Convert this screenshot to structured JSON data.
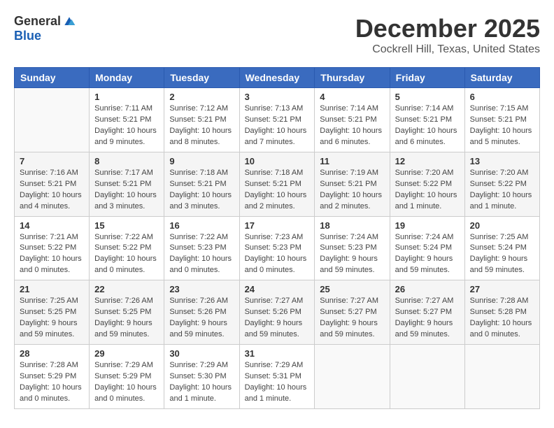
{
  "header": {
    "logo_general": "General",
    "logo_blue": "Blue",
    "month": "December 2025",
    "location": "Cockrell Hill, Texas, United States"
  },
  "weekdays": [
    "Sunday",
    "Monday",
    "Tuesday",
    "Wednesday",
    "Thursday",
    "Friday",
    "Saturday"
  ],
  "weeks": [
    [
      {
        "day": "",
        "info": ""
      },
      {
        "day": "1",
        "info": "Sunrise: 7:11 AM\nSunset: 5:21 PM\nDaylight: 10 hours\nand 9 minutes."
      },
      {
        "day": "2",
        "info": "Sunrise: 7:12 AM\nSunset: 5:21 PM\nDaylight: 10 hours\nand 8 minutes."
      },
      {
        "day": "3",
        "info": "Sunrise: 7:13 AM\nSunset: 5:21 PM\nDaylight: 10 hours\nand 7 minutes."
      },
      {
        "day": "4",
        "info": "Sunrise: 7:14 AM\nSunset: 5:21 PM\nDaylight: 10 hours\nand 6 minutes."
      },
      {
        "day": "5",
        "info": "Sunrise: 7:14 AM\nSunset: 5:21 PM\nDaylight: 10 hours\nand 6 minutes."
      },
      {
        "day": "6",
        "info": "Sunrise: 7:15 AM\nSunset: 5:21 PM\nDaylight: 10 hours\nand 5 minutes."
      }
    ],
    [
      {
        "day": "7",
        "info": "Sunrise: 7:16 AM\nSunset: 5:21 PM\nDaylight: 10 hours\nand 4 minutes."
      },
      {
        "day": "8",
        "info": "Sunrise: 7:17 AM\nSunset: 5:21 PM\nDaylight: 10 hours\nand 3 minutes."
      },
      {
        "day": "9",
        "info": "Sunrise: 7:18 AM\nSunset: 5:21 PM\nDaylight: 10 hours\nand 3 minutes."
      },
      {
        "day": "10",
        "info": "Sunrise: 7:18 AM\nSunset: 5:21 PM\nDaylight: 10 hours\nand 2 minutes."
      },
      {
        "day": "11",
        "info": "Sunrise: 7:19 AM\nSunset: 5:21 PM\nDaylight: 10 hours\nand 2 minutes."
      },
      {
        "day": "12",
        "info": "Sunrise: 7:20 AM\nSunset: 5:22 PM\nDaylight: 10 hours\nand 1 minute."
      },
      {
        "day": "13",
        "info": "Sunrise: 7:20 AM\nSunset: 5:22 PM\nDaylight: 10 hours\nand 1 minute."
      }
    ],
    [
      {
        "day": "14",
        "info": "Sunrise: 7:21 AM\nSunset: 5:22 PM\nDaylight: 10 hours\nand 0 minutes."
      },
      {
        "day": "15",
        "info": "Sunrise: 7:22 AM\nSunset: 5:22 PM\nDaylight: 10 hours\nand 0 minutes."
      },
      {
        "day": "16",
        "info": "Sunrise: 7:22 AM\nSunset: 5:23 PM\nDaylight: 10 hours\nand 0 minutes."
      },
      {
        "day": "17",
        "info": "Sunrise: 7:23 AM\nSunset: 5:23 PM\nDaylight: 10 hours\nand 0 minutes."
      },
      {
        "day": "18",
        "info": "Sunrise: 7:24 AM\nSunset: 5:23 PM\nDaylight: 9 hours\nand 59 minutes."
      },
      {
        "day": "19",
        "info": "Sunrise: 7:24 AM\nSunset: 5:24 PM\nDaylight: 9 hours\nand 59 minutes."
      },
      {
        "day": "20",
        "info": "Sunrise: 7:25 AM\nSunset: 5:24 PM\nDaylight: 9 hours\nand 59 minutes."
      }
    ],
    [
      {
        "day": "21",
        "info": "Sunrise: 7:25 AM\nSunset: 5:25 PM\nDaylight: 9 hours\nand 59 minutes."
      },
      {
        "day": "22",
        "info": "Sunrise: 7:26 AM\nSunset: 5:25 PM\nDaylight: 9 hours\nand 59 minutes."
      },
      {
        "day": "23",
        "info": "Sunrise: 7:26 AM\nSunset: 5:26 PM\nDaylight: 9 hours\nand 59 minutes."
      },
      {
        "day": "24",
        "info": "Sunrise: 7:27 AM\nSunset: 5:26 PM\nDaylight: 9 hours\nand 59 minutes."
      },
      {
        "day": "25",
        "info": "Sunrise: 7:27 AM\nSunset: 5:27 PM\nDaylight: 9 hours\nand 59 minutes."
      },
      {
        "day": "26",
        "info": "Sunrise: 7:27 AM\nSunset: 5:27 PM\nDaylight: 9 hours\nand 59 minutes."
      },
      {
        "day": "27",
        "info": "Sunrise: 7:28 AM\nSunset: 5:28 PM\nDaylight: 10 hours\nand 0 minutes."
      }
    ],
    [
      {
        "day": "28",
        "info": "Sunrise: 7:28 AM\nSunset: 5:29 PM\nDaylight: 10 hours\nand 0 minutes."
      },
      {
        "day": "29",
        "info": "Sunrise: 7:29 AM\nSunset: 5:29 PM\nDaylight: 10 hours\nand 0 minutes."
      },
      {
        "day": "30",
        "info": "Sunrise: 7:29 AM\nSunset: 5:30 PM\nDaylight: 10 hours\nand 1 minute."
      },
      {
        "day": "31",
        "info": "Sunrise: 7:29 AM\nSunset: 5:31 PM\nDaylight: 10 hours\nand 1 minute."
      },
      {
        "day": "",
        "info": ""
      },
      {
        "day": "",
        "info": ""
      },
      {
        "day": "",
        "info": ""
      }
    ]
  ]
}
